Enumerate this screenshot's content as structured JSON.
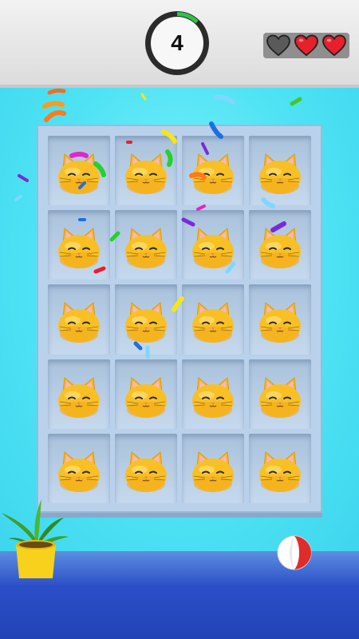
{
  "hud": {
    "timer_value": "4",
    "timer_progress": 0.12,
    "lives": [
      {
        "state": "empty",
        "icon": "heart-empty-icon"
      },
      {
        "state": "full",
        "icon": "heart-full-icon"
      },
      {
        "state": "full",
        "icon": "heart-full-icon"
      }
    ]
  },
  "scene": {
    "shelf_rows": 5,
    "shelf_columns": 4,
    "cells": [
      {
        "item": "cat-face"
      },
      {
        "item": "cat-face"
      },
      {
        "item": "cat-face"
      },
      {
        "item": "cat-face"
      },
      {
        "item": "cat-face"
      },
      {
        "item": "cat-face"
      },
      {
        "item": "cat-face"
      },
      {
        "item": "cat-face"
      },
      {
        "item": "cat-face"
      },
      {
        "item": "cat-face"
      },
      {
        "item": "cat-face"
      },
      {
        "item": "cat-face"
      },
      {
        "item": "cat-face"
      },
      {
        "item": "cat-face"
      },
      {
        "item": "cat-face"
      },
      {
        "item": "cat-face"
      },
      {
        "item": "cat-face"
      },
      {
        "item": "cat-face"
      },
      {
        "item": "cat-face"
      },
      {
        "item": "cat-face"
      }
    ],
    "decor": [
      "potted-plant",
      "beach-ball"
    ]
  },
  "colors": {
    "wall": "#49e2f5",
    "floor": "#2c4fc8",
    "cabinet": "#b9d1ea",
    "cat": "#f8c025",
    "heart": "#e8202b",
    "timer_ring": "#2ec24a"
  }
}
